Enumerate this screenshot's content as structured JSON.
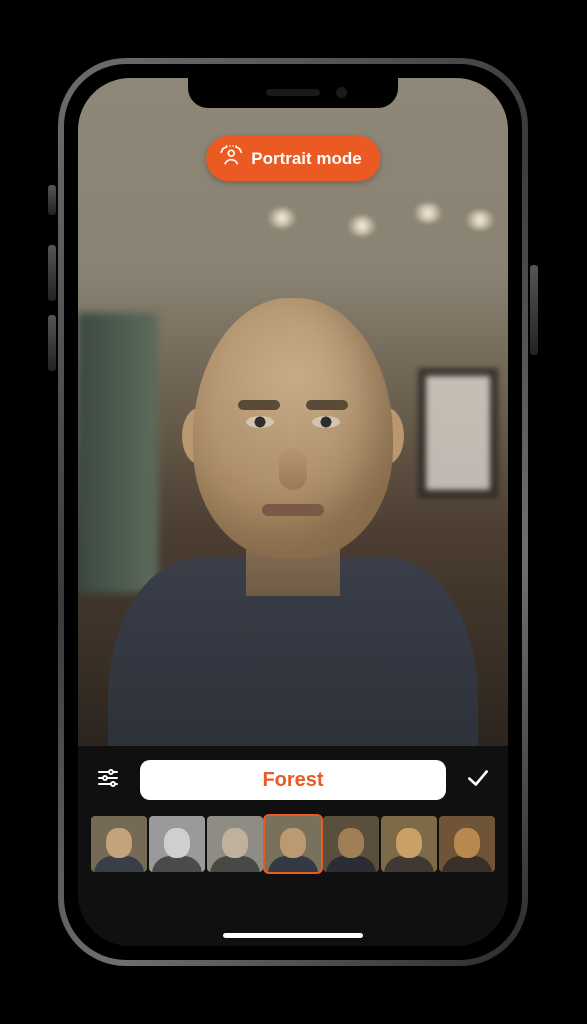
{
  "mode_badge": {
    "label": "Portrait mode",
    "icon": "portrait-mode-icon"
  },
  "filter_bar": {
    "adjust_icon": "sliders-icon",
    "confirm_icon": "checkmark-icon",
    "selected_filter_label": "Forest",
    "selected_index": 3
  },
  "filters": [
    {
      "name": "filter-0",
      "bg": "#756a56",
      "skin": "#c3a27c",
      "body": "#3a3e48"
    },
    {
      "name": "filter-1",
      "bg": "#9a9a9a",
      "skin": "#cfcfcf",
      "body": "#4a4a4a"
    },
    {
      "name": "filter-2",
      "bg": "#8f8c85",
      "skin": "#bfb19d",
      "body": "#484845"
    },
    {
      "name": "filter-3",
      "bg": "#7a715c",
      "skin": "#bb9a72",
      "body": "#343a43"
    },
    {
      "name": "filter-4",
      "bg": "#5a4f3c",
      "skin": "#a07e56",
      "body": "#2a2d34"
    },
    {
      "name": "filter-5",
      "bg": "#7d6a46",
      "skin": "#caa066",
      "body": "#3e3a33"
    },
    {
      "name": "filter-6",
      "bg": "#6f5438",
      "skin": "#b8894f",
      "body": "#3b2f2a"
    }
  ],
  "colors": {
    "accent": "#ec5a23"
  }
}
